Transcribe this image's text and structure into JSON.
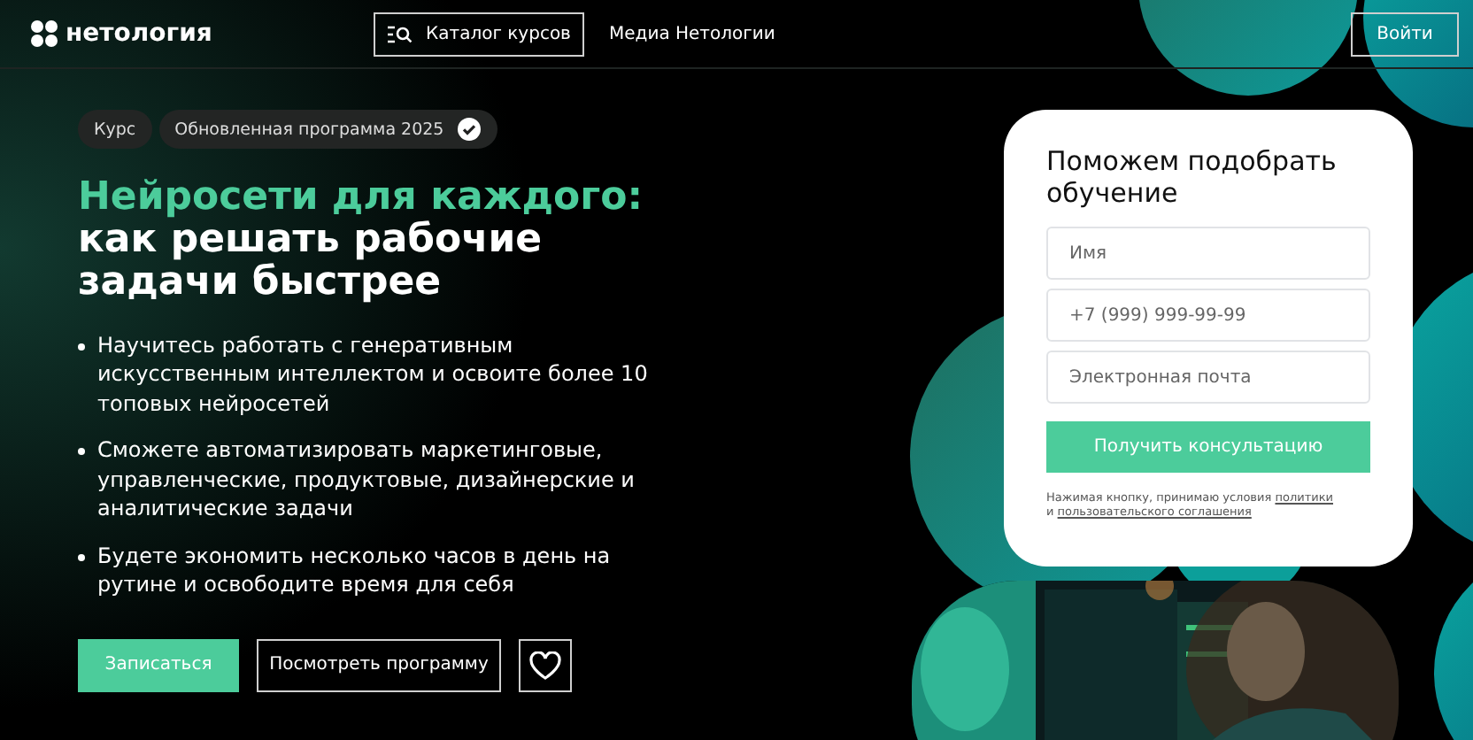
{
  "header": {
    "logo": "нетология",
    "catalog_button": "Каталог курсов",
    "media_link": "Медиа Нетологии",
    "login_button": "Войти"
  },
  "tags": [
    {
      "label": "Курс",
      "verified": false
    },
    {
      "label": "Обновленная программа 2025",
      "verified": true
    }
  ],
  "title": {
    "accent": "Нейросети для каждого:",
    "rest": "как решать рабочие задачи быстрее"
  },
  "bullets": [
    "Научитесь работать с генеративным искусственным интеллектом и освоите более 10 топовых нейросетей",
    "Сможете автоматизировать маркетинговые, управленческие, продуктовые, дизайнерские и аналитические задачи",
    "Будете экономить несколько часов в день на рутине и освободите время для себя"
  ],
  "actions": {
    "enroll_button": "Записаться",
    "program_button": "Посмотреть программу"
  },
  "form": {
    "heading": "Поможем подобрать обучение",
    "fields": [
      {
        "placeholder": "Имя"
      },
      {
        "placeholder": "+7 (999) 999-99-99"
      },
      {
        "placeholder": "Электронная почта"
      }
    ],
    "submit_button": "Получить консультацию",
    "consent_text": "Нажимая кнопку, принимаю условия",
    "policy_link": "политики",
    "and_text": "и",
    "agreement_link": "пользовательского соглашения"
  }
}
